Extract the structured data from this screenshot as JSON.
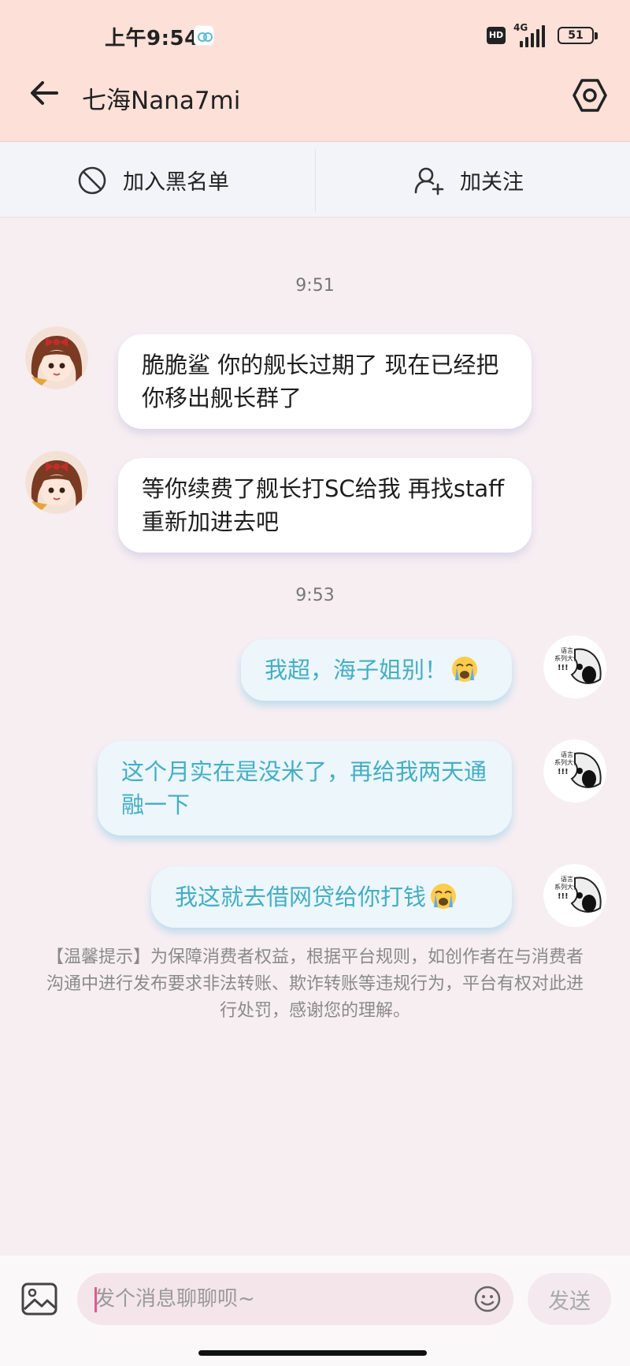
{
  "status_bar": {
    "time": "上午9:54",
    "hd": "HD",
    "network": "4G",
    "battery": "51",
    "battery_level": 0.51
  },
  "header": {
    "title": "七海Nana7mi",
    "back_icon": "arrow-left-icon",
    "settings_icon": "hexagon-settings-icon"
  },
  "actions": {
    "block_label": "加入黑名单",
    "block_icon": "block-icon",
    "follow_label": "加关注",
    "follow_icon": "add-user-icon"
  },
  "messages": [
    {
      "type": "time",
      "text": "9:51"
    },
    {
      "type": "in",
      "text": "脆脆鲨  你的舰长过期了  现在已经把你移出舰长群了"
    },
    {
      "type": "in",
      "text": "等你续费了舰长打SC给我  再找staff重新加进去吧"
    },
    {
      "type": "time",
      "text": "9:53"
    },
    {
      "type": "out",
      "text": "我超，海子姐别！",
      "emoji": "loudly-crying-emoji"
    },
    {
      "type": "out",
      "text": "这个月实在是没米了，再给我两天通融一下"
    },
    {
      "type": "out",
      "text": "我这就去借网贷给你打钱",
      "emoji": "loudly-crying-emoji"
    }
  ],
  "notice": "【温馨提示】为保障消费者权益，根据平台规则，如创作者在与消费者沟通中进行发布要求非法转账、欺诈转账等违规行为，平台有权对此进行处罚，感谢您的理解。",
  "composer": {
    "placeholder": "发个消息聊聊呗~",
    "send_label": "发送",
    "image_icon": "image-icon",
    "emoji_icon": "smiley-icon"
  },
  "colors": {
    "header_bg": "#fde0d8",
    "action_bar_bg": "#f3f4f9",
    "page_bg": "#f7eef2",
    "outgoing_text": "#44aec4",
    "outgoing_bubble": "#ecf6fb"
  }
}
